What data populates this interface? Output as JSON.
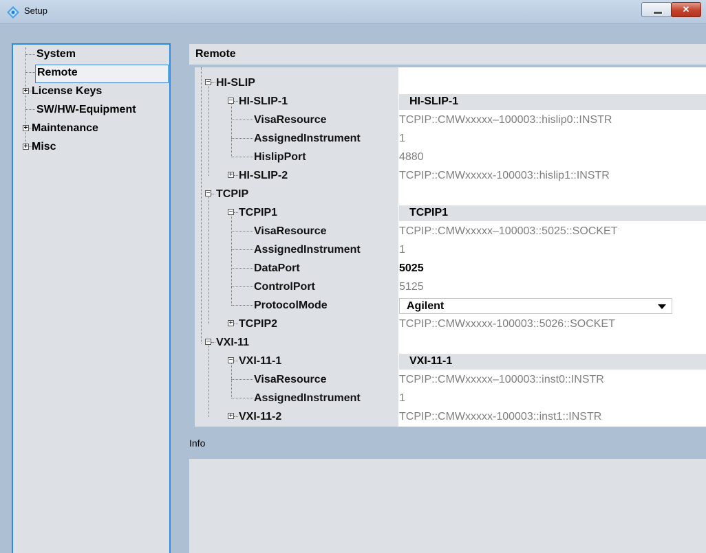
{
  "window": {
    "title": "Setup",
    "close_glyph": "✕"
  },
  "sidebar": {
    "items": [
      {
        "label": "System",
        "expander": ""
      },
      {
        "label": "Remote",
        "expander": ""
      },
      {
        "label": "License Keys",
        "expander": "+"
      },
      {
        "label": "SW/HW-Equipment",
        "expander": ""
      },
      {
        "label": "Maintenance",
        "expander": "+"
      },
      {
        "label": "Misc",
        "expander": "+"
      }
    ],
    "selected": "Remote"
  },
  "main": {
    "title": "Remote"
  },
  "tree": {
    "rows": [
      {
        "name": "HI-SLIP",
        "value": "",
        "expander": "−"
      },
      {
        "name": "HI-SLIP-1",
        "value": "HI-SLIP-1",
        "expander": "−"
      },
      {
        "name": "VisaResource",
        "value": "TCPIP::CMWxxxxx–100003::hislip0::INSTR"
      },
      {
        "name": "AssignedInstrument",
        "value": "1"
      },
      {
        "name": "HislipPort",
        "value": "4880"
      },
      {
        "name": "HI-SLIP-2",
        "value": "TCPIP::CMWxxxxx-100003::hislip1::INSTR",
        "expander": "+"
      },
      {
        "name": "TCPIP",
        "value": "",
        "expander": "−"
      },
      {
        "name": "TCPIP1",
        "value": "TCPIP1",
        "expander": "−"
      },
      {
        "name": "VisaResource",
        "value": "TCPIP::CMWxxxxx–100003::5025::SOCKET"
      },
      {
        "name": "AssignedInstrument",
        "value": "1"
      },
      {
        "name": "DataPort",
        "value": "5025"
      },
      {
        "name": "ControlPort",
        "value": "5125"
      },
      {
        "name": "ProtocolMode",
        "value": "Agilent"
      },
      {
        "name": "TCPIP2",
        "value": "TCPIP::CMWxxxxx-100003::5026::SOCKET",
        "expander": "+"
      },
      {
        "name": "VXI-11",
        "value": "",
        "expander": "−"
      },
      {
        "name": "VXI-11-1",
        "value": "VXI-11-1",
        "expander": "−"
      },
      {
        "name": "VisaResource",
        "value": "TCPIP::CMWxxxxx–100003::inst0::INSTR"
      },
      {
        "name": "AssignedInstrument",
        "value": "1"
      },
      {
        "name": "VXI-11-2",
        "value": "TCPIP::CMWxxxxx-100003::inst1::INSTR",
        "expander": "+"
      }
    ]
  },
  "info": {
    "title": "Info"
  },
  "colors": {
    "accent": "#2f8ae3",
    "panel": "#dde1e6",
    "chrome": "#adbfd3",
    "value_gray": "#7f7f7f"
  }
}
